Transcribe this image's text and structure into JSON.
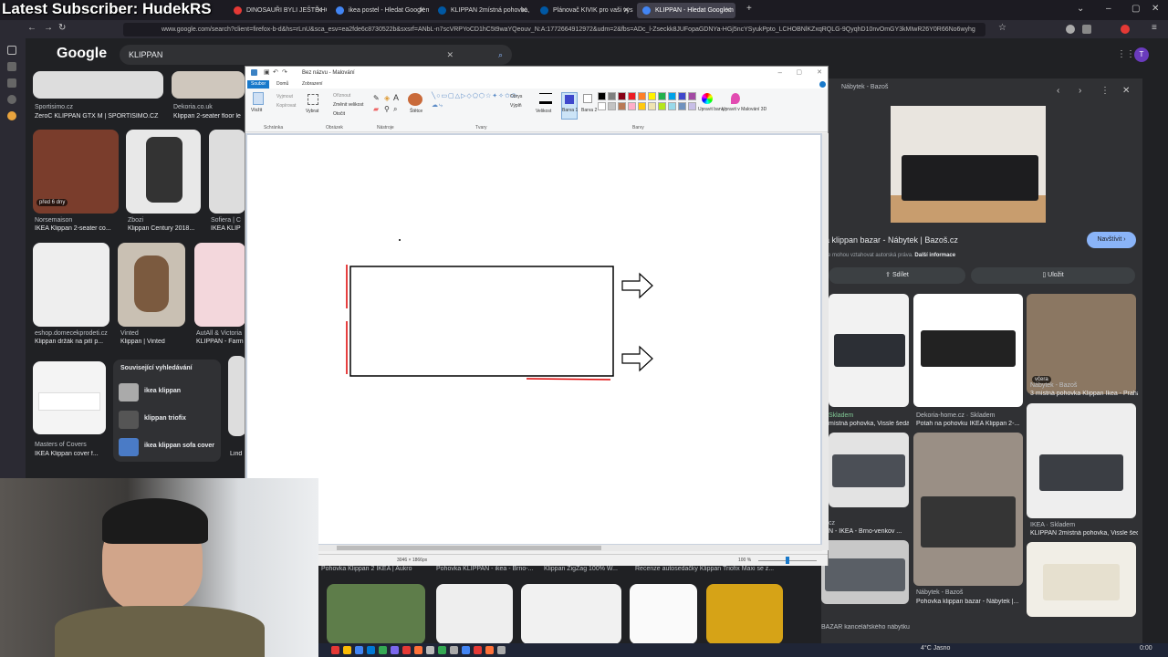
{
  "overlay": {
    "subscriber_text": "Latest Subscriber: HudekRS"
  },
  "browser": {
    "tabs": [
      {
        "label": "DINOSAUŘI BYLI JEŠTĚ HORŠÍ",
        "active": false,
        "color": "#e53935"
      },
      {
        "label": "ikea postel - Hledat Googlem",
        "active": false,
        "color": "#4285f4"
      },
      {
        "label": "KLIPPAN 2místná pohovka, Bor",
        "active": false,
        "color": "#0058a3"
      },
      {
        "label": "Plánovač KIVIK pro vaši vysněn",
        "active": false,
        "color": "#0058a3"
      },
      {
        "label": "KLIPPAN - Hledat Googlem",
        "active": true,
        "color": "#4285f4"
      }
    ],
    "url": "www.google.com/search?client=firefox-b-d&hs=rLnU&sca_esv=ea2fde6c8730522b&sxsrf=ANbL-n7scVRPYoCD1hC5t9waYQeouv_N:A:1772664912972&udm=2&fbs=ADc_l-Zseckk8JUFopaGDNYa-HGj5ncYSyukPpto_LCHOBNlKZxqRQLG-9QyqhD10nvOmGY3kMIwR26Y0R66No6wyhg",
    "icons": [
      "back-icon",
      "forward-icon",
      "reload-icon",
      "extensions-icon",
      "profile-icon",
      "menu-icon"
    ]
  },
  "google": {
    "logo": "Google",
    "search_value": "KLIPPAN",
    "results_row1": [
      {
        "source": "Sportisimo.cz",
        "title": "ZeroC KLIPPAN GTX M | SPORTISIMO.CZ"
      },
      {
        "source": "Dekoria.co.uk",
        "title": "Klippan 2-seater floor le"
      }
    ],
    "results_row2": [
      {
        "source": "Norsemaison",
        "title": "IKEA Klippan 2-seater co...",
        "badge": "před 6 dny"
      },
      {
        "source": "Zbozi",
        "title": "Klippan Century 2018..."
      },
      {
        "source": "Sofiera | C",
        "title": "IKEA KLIP"
      }
    ],
    "results_row3": [
      {
        "source": "eshop.domecekprodeti.cz",
        "title": "Klippan držák na pití p..."
      },
      {
        "source": "Vinted",
        "title": "Klippan | Vinted"
      },
      {
        "source": "AutAll & Victoria",
        "title": "KLIPPAN - Farm"
      }
    ],
    "results_row4": [
      {
        "source": "Masters of Covers",
        "title": "IKEA Klippan cover f..."
      },
      {
        "source": "",
        "title": "Lind"
      }
    ],
    "related": {
      "heading": "Související vyhledávání",
      "items": [
        "ikea klippan",
        "klippan triofix",
        "ikea klippan sofa cover"
      ]
    },
    "bottom_titles": [
      "Pohovka Klippan 2 IKEA | Aukro",
      "Pohovka KLIPPAN - ikea - Brno-...",
      "Klippan ZigZag 100% W...",
      "Recenze autosedačky Klippan Triofix Maxi se z..."
    ]
  },
  "paint": {
    "title": "Bez názvu - Malování",
    "tabs": [
      "Soubor",
      "Domů",
      "Zobrazení"
    ],
    "ribbon_groups": [
      "Schránka",
      "Obrázek",
      "Nástroje",
      "Tvary",
      "Barvy"
    ],
    "clipboard": {
      "paste": "Vložit",
      "cut": "Vyjmout",
      "copy": "Kopírovat"
    },
    "image": {
      "select": "Vybrat",
      "crop": "Oříznout",
      "resize": "Změnit velikost",
      "rotate": "Otočit"
    },
    "brushes": "Štětce",
    "shapes": {
      "outline": "Obrys",
      "fill": "Výplň"
    },
    "size": "Velikost",
    "color1": "Barva 1",
    "color2": "Barva 2",
    "edit_colors": "Upravit barvy",
    "paint3d": "Upravit v Malování 3D",
    "status_size": "3046 × 1866px",
    "zoom": "100 %",
    "palette": [
      "#000000",
      "#7f7f7f",
      "#880015",
      "#ed1c24",
      "#ff7f27",
      "#fff200",
      "#22b14c",
      "#00a2e8",
      "#3f48cc",
      "#a349a4",
      "#ffffff",
      "#c3c3c3",
      "#b97a57",
      "#ffaec9",
      "#ffc90e",
      "#efe4b0",
      "#b5e61d",
      "#99d9ea",
      "#7092be",
      "#c8bfe7"
    ]
  },
  "image_panel": {
    "source": "Nábytek - Bazoš",
    "title": "a klippan bazar - Nábytek | Bazoš.cz",
    "visit": "Navštívit",
    "note": "se mohou vztahovat autorská práva.",
    "more_info": "Další informace",
    "share": "Sdílet",
    "save": "Uložit",
    "grid": [
      {
        "source": "",
        "title": ""
      },
      {
        "source": "",
        "title": ""
      },
      {
        "source": "Nábytek - Bazoš",
        "title": "3 místná pohovka Klippan Ikea - Praha ...",
        "badge": "včera"
      },
      {
        "source": "Skladem",
        "title": "místná pohovka, Vissle šedá ..."
      },
      {
        "source": "Dekoria-home.cz · Skladem",
        "title": "Potah na pohovku IKEA Klippan 2-..."
      },
      {
        "source": "IKEA · Skladem",
        "title": "KLIPPAN 2místná pohovka, Vissle šedá ..."
      },
      {
        "source": "cz",
        "title": "N - IKEA - Brno-venkov ..."
      },
      {
        "source": "Nábytek - Bazoš",
        "title": "Pohovka klippan bazar - Nábytek |..."
      },
      {
        "source": "BAZAR kancelářského nábytku",
        "title": ""
      }
    ]
  },
  "taskbar": {
    "weather": "4°C Jasno",
    "time": "0:00"
  },
  "colors": {
    "accent": "#8ab4f8",
    "paint_blue": "#1979ca",
    "bg_dark": "#202124"
  }
}
